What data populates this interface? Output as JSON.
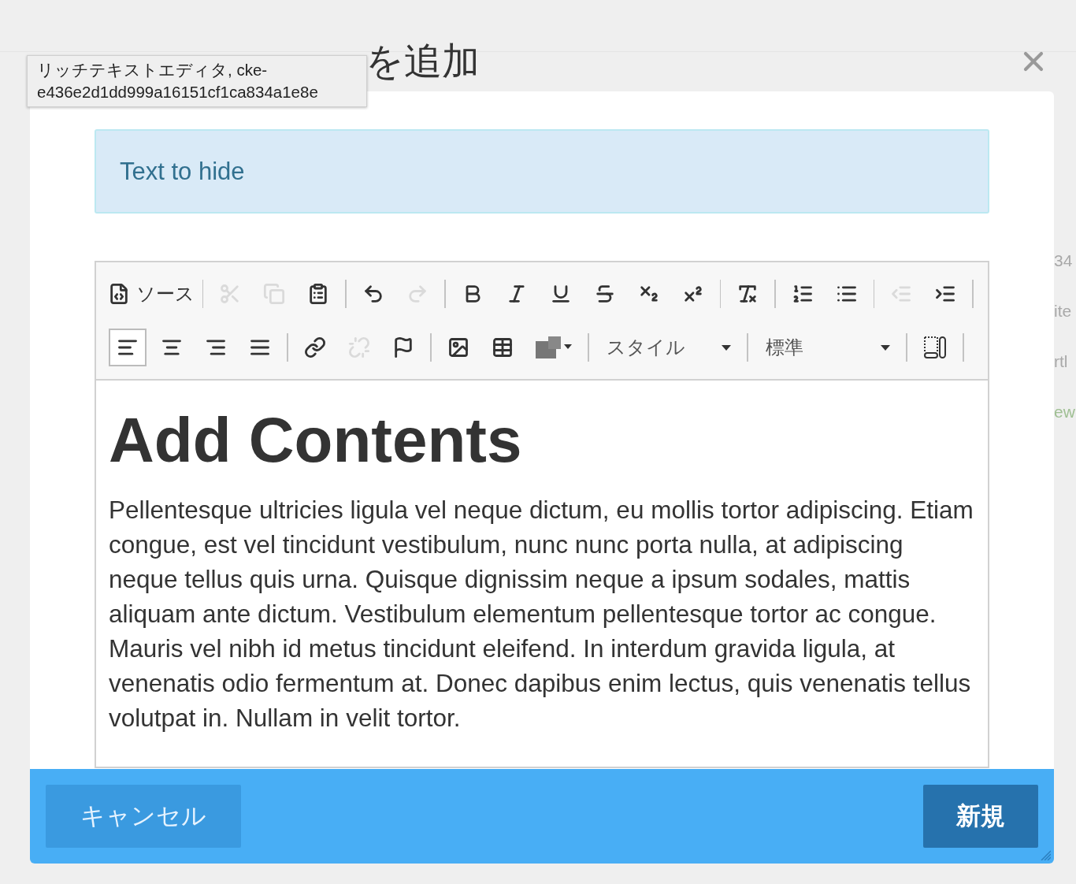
{
  "background_texts": [
    "34",
    "ite",
    "rtl",
    "ew"
  ],
  "dialog": {
    "title": "を追加",
    "tooltip": "リッチテキストエディタ, cke-e436e2d1dd999a16151cf1ca834a1e8e",
    "alert": "Text to hide",
    "toolbar": [
      [
        {
          "kind": "labeled",
          "label": "ソース",
          "disabled": false,
          "selected": false
        },
        {
          "kind": "separator"
        },
        {
          "kind": "button",
          "disabled": true,
          "selected": false
        },
        {
          "kind": "button",
          "disabled": true,
          "selected": false
        },
        {
          "kind": "button",
          "disabled": false,
          "selected": false
        },
        {
          "kind": "separator"
        },
        {
          "kind": "button",
          "disabled": false,
          "selected": false
        },
        {
          "kind": "button",
          "disabled": true,
          "selected": false
        },
        {
          "kind": "separator"
        },
        {
          "kind": "button",
          "disabled": false,
          "selected": false
        },
        {
          "kind": "button",
          "disabled": false,
          "selected": false
        },
        {
          "kind": "button",
          "disabled": false,
          "selected": false
        },
        {
          "kind": "button",
          "disabled": false,
          "selected": false
        },
        {
          "kind": "button",
          "disabled": false,
          "selected": false
        },
        {
          "kind": "button",
          "disabled": false,
          "selected": false
        },
        {
          "kind": "separator"
        },
        {
          "kind": "button",
          "disabled": false,
          "selected": false
        },
        {
          "kind": "separator"
        },
        {
          "kind": "button",
          "disabled": false,
          "selected": false
        },
        {
          "kind": "button",
          "disabled": false,
          "selected": false
        },
        {
          "kind": "separator"
        },
        {
          "kind": "button",
          "disabled": true,
          "selected": false
        },
        {
          "kind": "button",
          "disabled": false,
          "selected": false
        },
        {
          "kind": "separator"
        }
      ],
      [
        {
          "kind": "button",
          "disabled": false,
          "selected": true
        },
        {
          "kind": "button",
          "disabled": false,
          "selected": false
        },
        {
          "kind": "button",
          "disabled": false,
          "selected": false
        },
        {
          "kind": "button",
          "disabled": false,
          "selected": false
        },
        {
          "kind": "separator"
        },
        {
          "kind": "button",
          "disabled": false,
          "selected": false
        },
        {
          "kind": "button",
          "disabled": true,
          "selected": false
        },
        {
          "kind": "button",
          "disabled": false,
          "selected": false
        },
        {
          "kind": "separator"
        },
        {
          "kind": "button",
          "disabled": false,
          "selected": false
        },
        {
          "kind": "button",
          "disabled": false,
          "selected": false
        },
        {
          "kind": "menu",
          "disabled": false,
          "selected": false
        },
        {
          "kind": "separator"
        },
        {
          "kind": "combo",
          "label": "スタイル"
        },
        {
          "kind": "separator"
        },
        {
          "kind": "combo",
          "label": "標準"
        },
        {
          "kind": "separator"
        },
        {
          "kind": "button",
          "disabled": false,
          "selected": false
        },
        {
          "kind": "separator"
        }
      ]
    ],
    "content": {
      "heading": "Add Contents",
      "paragraph": "Pellentesque ultricies ligula vel neque dictum, eu mollis tortor adipiscing. Etiam congue, est vel tincidunt vestibulum, nunc nunc porta nulla, at adipiscing neque tellus quis urna. Quisque dignissim neque a ipsum sodales, mattis aliquam ante dictum. Vestibulum elementum pellentesque tortor ac congue. Mauris vel nibh id metus tincidunt eleifend. In interdum gravida ligula, at venenatis odio fermentum at. Donec dapibus enim lectus, quis venenatis tellus volutpat in. Nullam in velit tortor."
    },
    "buttons": [
      {
        "kind": "secondary",
        "label": "キャンセル"
      },
      {
        "kind": "primary",
        "label": "新規"
      }
    ]
  }
}
